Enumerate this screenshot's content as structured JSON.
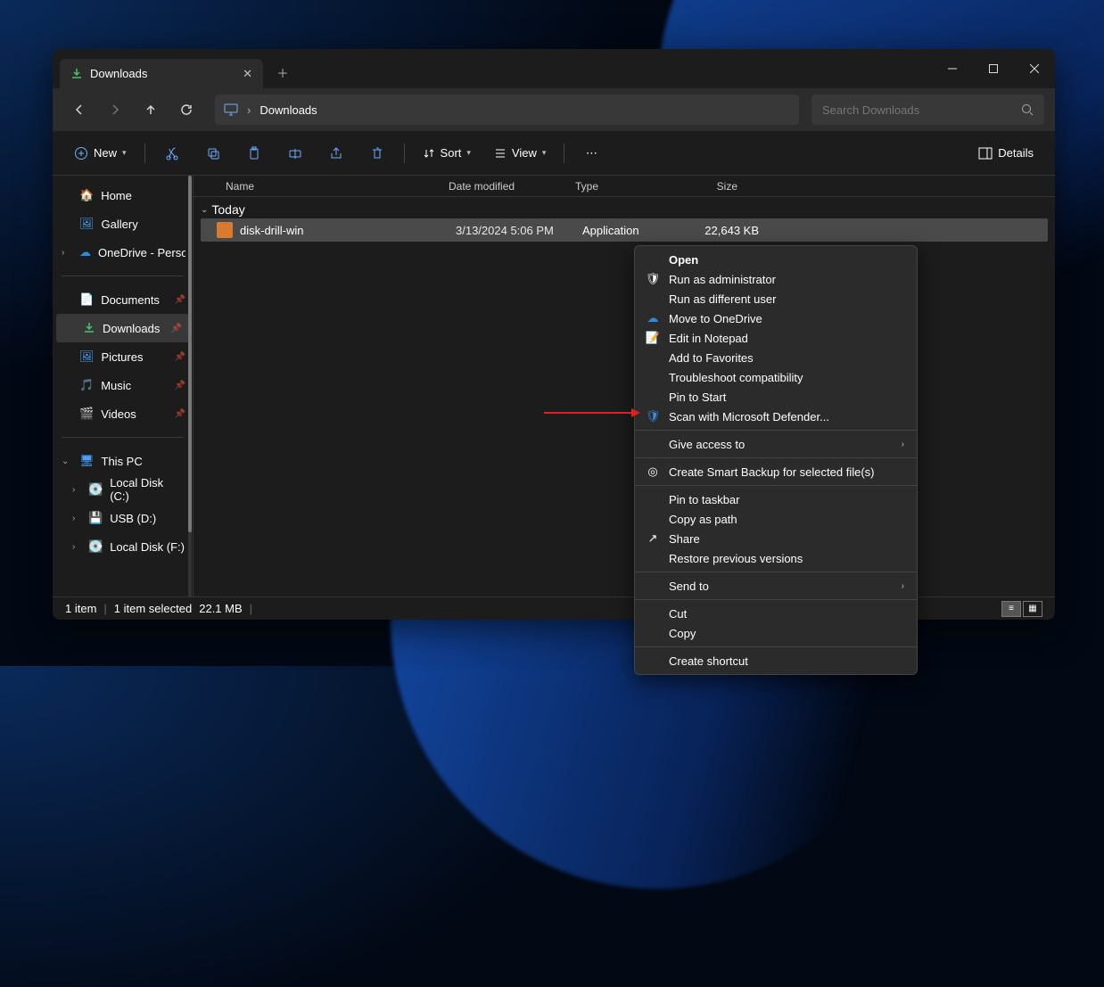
{
  "tab": {
    "title": "Downloads"
  },
  "address": {
    "location": "Downloads"
  },
  "search": {
    "placeholder": "Search Downloads"
  },
  "toolbar": {
    "new": "New",
    "sort": "Sort",
    "view": "View",
    "details": "Details"
  },
  "sidebar": {
    "home": "Home",
    "gallery": "Gallery",
    "onedrive": "OneDrive - Perso",
    "documents": "Documents",
    "downloads": "Downloads",
    "pictures": "Pictures",
    "music": "Music",
    "videos": "Videos",
    "thispc": "This PC",
    "diskC": "Local Disk (C:)",
    "usbD": "USB (D:)",
    "diskF": "Local Disk (F:)"
  },
  "columns": {
    "name": "Name",
    "date": "Date modified",
    "type": "Type",
    "size": "Size"
  },
  "group": "Today",
  "file": {
    "name": "disk-drill-win",
    "date": "3/13/2024 5:06 PM",
    "type": "Application",
    "size": "22,643 KB"
  },
  "status": {
    "items": "1 item",
    "selected": "1 item selected",
    "size": "22.1 MB"
  },
  "context": {
    "open": "Open",
    "runadmin": "Run as administrator",
    "rundiff": "Run as different user",
    "onedrive": "Move to OneDrive",
    "notepad": "Edit in Notepad",
    "favorites": "Add to Favorites",
    "troubleshoot": "Troubleshoot compatibility",
    "pinstart": "Pin to Start",
    "defender": "Scan with Microsoft Defender...",
    "giveaccess": "Give access to",
    "smartbackup": "Create Smart Backup for selected file(s)",
    "pintaskbar": "Pin to taskbar",
    "copypath": "Copy as path",
    "share": "Share",
    "restore": "Restore previous versions",
    "sendto": "Send to",
    "cut": "Cut",
    "copy": "Copy",
    "shortcut": "Create shortcut"
  }
}
